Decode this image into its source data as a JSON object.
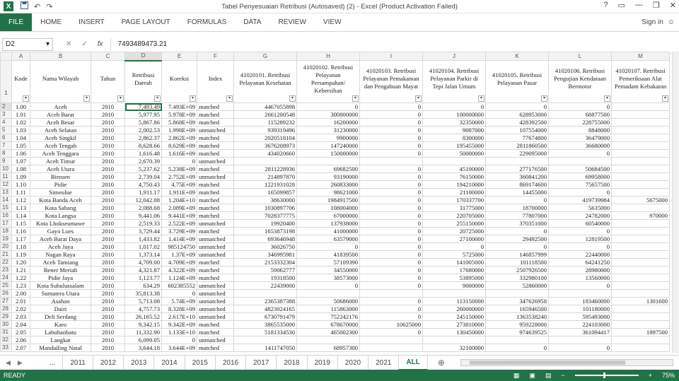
{
  "app": {
    "logo": "X",
    "title": "Tabel Penyesuaian Retribusi (Autosaved) (2) - Excel (Product Activation Failed)",
    "help": "?",
    "signin": "Sign in"
  },
  "qat": {
    "save_icon": "save-icon",
    "undo": "↶",
    "redo": "↷"
  },
  "window_controls": {
    "ribbon_opts": "▭",
    "min": "—",
    "restore": "❐",
    "close": "✕"
  },
  "ribbon": {
    "tabs": [
      "FILE",
      "HOME",
      "INSERT",
      "PAGE LAYOUT",
      "FORMULAS",
      "DATA",
      "REVIEW",
      "VIEW"
    ]
  },
  "formula_bar": {
    "name_box": "D2",
    "cancel": "✕",
    "enter": "✓",
    "fx": "fx",
    "value": "7493489473.21"
  },
  "columns": [
    "",
    "A",
    "B",
    "C",
    "D",
    "E",
    "F",
    "G",
    "H",
    "I",
    "J",
    "K",
    "L",
    "M"
  ],
  "headers": [
    "Kode",
    "Nama Wilayah",
    "Tahun",
    "Retribusi Daerah",
    "Koreksi",
    "Index",
    "41020101. Retribusi Pelayanan Kesehatan",
    "41020102. Retribusi Pelayanan Persampahan/ Kebersihan",
    "41020103. Retribusi Pelayanan Pemakaman dan Pengabuan Mayat",
    "41020104. Retribusi Pelayanan Parkir di Tepi Jalan Umum",
    "41020105. Retribusi Pelayanan Pasar",
    "41020106. Retribusi Pengujian Kendaraan Bermotor",
    "41020107. Retribusi Pemeriksaan Alat Pemadam Kebakaran"
  ],
  "rows": [
    [
      "2",
      "1.00",
      "Aceh",
      "2010",
      "7,493.49",
      "7.493E+09",
      "matched",
      "4467055898",
      "0",
      "0",
      "0",
      "0",
      "0",
      ""
    ],
    [
      "3",
      "1.01",
      "Aceh Barat",
      "2010",
      "5,977.95",
      "5.978E+09",
      "matched",
      "2661200548",
      "300800000",
      "0",
      "100000000",
      "628953000",
      "68877500",
      ""
    ],
    [
      "4",
      "1.02",
      "Aceh Besar",
      "2010",
      "5,867.86",
      "5.868E+09",
      "matched",
      "115289232",
      "16200000",
      "0",
      "32350000",
      "428392500",
      "228755000",
      ""
    ],
    [
      "5",
      "1.03",
      "Aceh Selatan",
      "2010",
      "2,002.53",
      "1.998E+09",
      "unmatched",
      "939319496",
      "31230000",
      "0",
      "9087000",
      "107554000",
      "8848000",
      ""
    ],
    [
      "6",
      "1.04",
      "Aceh Singkil",
      "2010",
      "2,862.37",
      "2.862E+09",
      "matched",
      "2020518104",
      "9900000",
      "0",
      "8300000",
      "77674800",
      "36479000",
      ""
    ],
    [
      "7",
      "1.05",
      "Aceh Tengah",
      "2010",
      "8,628.66",
      "8.629E+09",
      "matched",
      "3676208973",
      "147240000",
      "0",
      "195455000",
      "2811860500",
      "36680000",
      ""
    ],
    [
      "8",
      "1.06",
      "Aceh Tenggara",
      "2010",
      "1,616.48",
      "1.616E+09",
      "matched",
      "434020660",
      "150000000",
      "0",
      "50000000",
      "229095000",
      "0",
      ""
    ],
    [
      "9",
      "1.07",
      "Aceh Timur",
      "2010",
      "2,670.39",
      "0",
      "unmatched",
      "",
      "",
      "",
      "",
      "",
      "",
      ""
    ],
    [
      "10",
      "1.08",
      "Aceh Utara",
      "2010",
      "5,237.62",
      "5.238E+09",
      "matched",
      "2811228936",
      "69682500",
      "0",
      "45100000",
      "277176500",
      "50684500",
      ""
    ],
    [
      "11",
      "1.09",
      "Bireuen",
      "2010",
      "2,739.04",
      "2.752E+09",
      "unmatched",
      "214897870",
      "93190000",
      "0",
      "76150000",
      "360841200",
      "69958000",
      ""
    ],
    [
      "12",
      "1.10",
      "Pidie",
      "2010",
      "4,750.43",
      "4.75E+09",
      "matched",
      "1221931028",
      "260833000",
      "0",
      "194210000",
      "869174600",
      "75657500",
      ""
    ],
    [
      "13",
      "1.11",
      "Simeulue",
      "2010",
      "1,911.17",
      "1.911E+09",
      "matched",
      "165099857",
      "98621000",
      "0",
      "21100000",
      "14455000",
      "0",
      ""
    ],
    [
      "14",
      "1.12",
      "Kota Banda Aceh",
      "2010",
      "12,042.08",
      "1.204E+10",
      "matched",
      "38630000",
      "1984917500",
      "0",
      "170337700",
      "0",
      "419739984",
      "5675000"
    ],
    [
      "15",
      "1.13",
      "Kota Sabang",
      "2010",
      "2,088.68",
      "2.089E+09",
      "matched",
      "1030897706",
      "108004000",
      "0",
      "31775000",
      "18700000",
      "5635000",
      ""
    ],
    [
      "16",
      "1.14",
      "Kota Langsa",
      "2010",
      "9,441.06",
      "9.441E+09",
      "matched",
      "7028377775",
      "67000000",
      "0",
      "220705000",
      "77807000",
      "24782000",
      "970000"
    ],
    [
      "17",
      "1.15",
      "Kota Lhokseumawe",
      "2010",
      "2,519.33",
      "2.522E+09",
      "unmatched",
      "19920400",
      "137938000",
      "0",
      "255150000",
      "370351000",
      "60540000",
      ""
    ],
    [
      "18",
      "1.16",
      "Gayo Lues",
      "2010",
      "3,729.44",
      "3.729E+09",
      "matched",
      "1653873198",
      "41000000",
      "0",
      "20725000",
      "0",
      "0",
      ""
    ],
    [
      "19",
      "1.17",
      "Aceh Barat Daya",
      "2010",
      "1,433.82",
      "1.414E+09",
      "unmatched",
      "693646948",
      "63579000",
      "0",
      "27100000",
      "29492500",
      "12819500",
      ""
    ],
    [
      "20",
      "1.18",
      "Aceh Jaya",
      "2010",
      "1,017.02",
      "985124750",
      "unmatched",
      "36026750",
      "0",
      "0",
      "0",
      "0",
      "0",
      ""
    ],
    [
      "21",
      "1.19",
      "Nagan Raya",
      "2010",
      "1,373.14",
      "1.37E+09",
      "unmatched",
      "346995981",
      "41839500",
      "0",
      "5725000",
      "146857999",
      "22440000",
      ""
    ],
    [
      "22",
      "1.20",
      "Aceh Tamiang",
      "2010",
      "4,709.00",
      "4.709E+09",
      "matched",
      "2153332304",
      "57109390",
      "0",
      "141005000",
      "101118500",
      "64241250",
      ""
    ],
    [
      "23",
      "1.21",
      "Bener Meriah",
      "2010",
      "4,321.87",
      "4.322E+09",
      "matched",
      "59062777",
      "34550000",
      "0",
      "17680000",
      "2507926500",
      "28980000",
      ""
    ],
    [
      "24",
      "1.22",
      "Pidie Jaya",
      "2010",
      "1,123.77",
      "1.124E+09",
      "matched",
      "19318500",
      "38573000",
      "0",
      "53895000",
      "332980100",
      "13560000",
      ""
    ],
    [
      "25",
      "1.23",
      "Kota Subulussalam",
      "2010",
      "634.29",
      "602385552",
      "unmatched",
      "22439000",
      "0",
      "0",
      "9000000",
      "52860000",
      "0",
      ""
    ],
    [
      "26",
      "2.00",
      "Sumatera Utara",
      "2010",
      "35,813.38",
      "0",
      "unmatched",
      "",
      "",
      "",
      "",
      "",
      "",
      ""
    ],
    [
      "27",
      "2.01",
      "Asahan",
      "2010",
      "5,713.08",
      "5.74E+09",
      "unmatched",
      "2365387388",
      "50686000",
      "0",
      "113150000",
      "347626958",
      "183460000",
      "1301600"
    ],
    [
      "28",
      "2.02",
      "Dairi",
      "2010",
      "4,757.73",
      "8.328E+09",
      "unmatched",
      "4823024165",
      "115863000",
      "0",
      "260000000",
      "165946500",
      "101180000",
      ""
    ],
    [
      "29",
      "2.03",
      "Deli Serdang",
      "2010",
      "26,165.52",
      "2.617E+10",
      "unmatched",
      "6730791479",
      "752242176",
      "0",
      "245150000",
      "1363538240",
      "595493000",
      ""
    ],
    [
      "30",
      "2.04",
      "Karo",
      "2010",
      "9,342.15",
      "9.342E+09",
      "matched",
      "3865535000",
      "678670000",
      "10625000",
      "273810000",
      "959228000",
      "224103000",
      ""
    ],
    [
      "31",
      "2.05",
      "Labuhanbatu",
      "2010",
      "11,332.90",
      "1.133E+10",
      "matched",
      "5181334530",
      "465002300",
      "0",
      "130450000",
      "974639525",
      "361094417",
      "1897500"
    ],
    [
      "32",
      "2.06",
      "Langkat",
      "2010",
      "6,099.05",
      "0",
      "unmatched",
      "",
      "",
      "",
      "",
      "",
      "",
      ""
    ],
    [
      "33",
      "2.07",
      "Mandailing Natal",
      "2010",
      "3,644.18",
      "3.644E+09",
      "matched",
      "1411747050",
      "68957300",
      "",
      "32100000",
      "0",
      "0",
      ""
    ]
  ],
  "sheets": {
    "nav_prev": "◀",
    "nav_next": "▶",
    "more": "...",
    "tabs": [
      "2011",
      "2012",
      "2013",
      "2014",
      "2015",
      "2016",
      "2017",
      "2018",
      "2019",
      "2020",
      "2021",
      "ALL"
    ],
    "active": "ALL",
    "add": "⊕"
  },
  "status": {
    "ready": "READY",
    "zoom": "75%",
    "minus": "−",
    "plus": "+"
  }
}
